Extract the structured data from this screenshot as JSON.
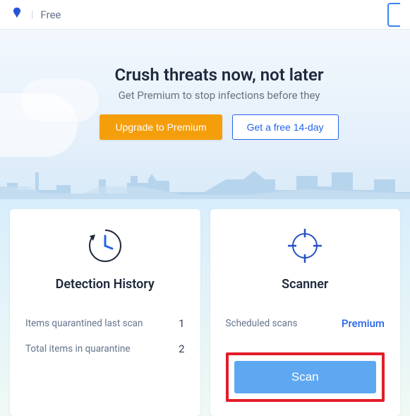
{
  "header": {
    "tier": "Free"
  },
  "hero": {
    "title": "Crush threats now, not later",
    "subtitle": "Get Premium to stop infections before they",
    "upgrade_label": "Upgrade to Premium",
    "trial_label": "Get a free 14-day"
  },
  "cards": {
    "history": {
      "title": "Detection History",
      "stat1_label": "Items quarantined last scan",
      "stat1_value": "1",
      "stat2_label": "Total items in quarantine",
      "stat2_value": "2"
    },
    "scanner": {
      "title": "Scanner",
      "sched_label": "Scheduled scans",
      "sched_value": "Premium",
      "scan_label": "Scan"
    }
  }
}
